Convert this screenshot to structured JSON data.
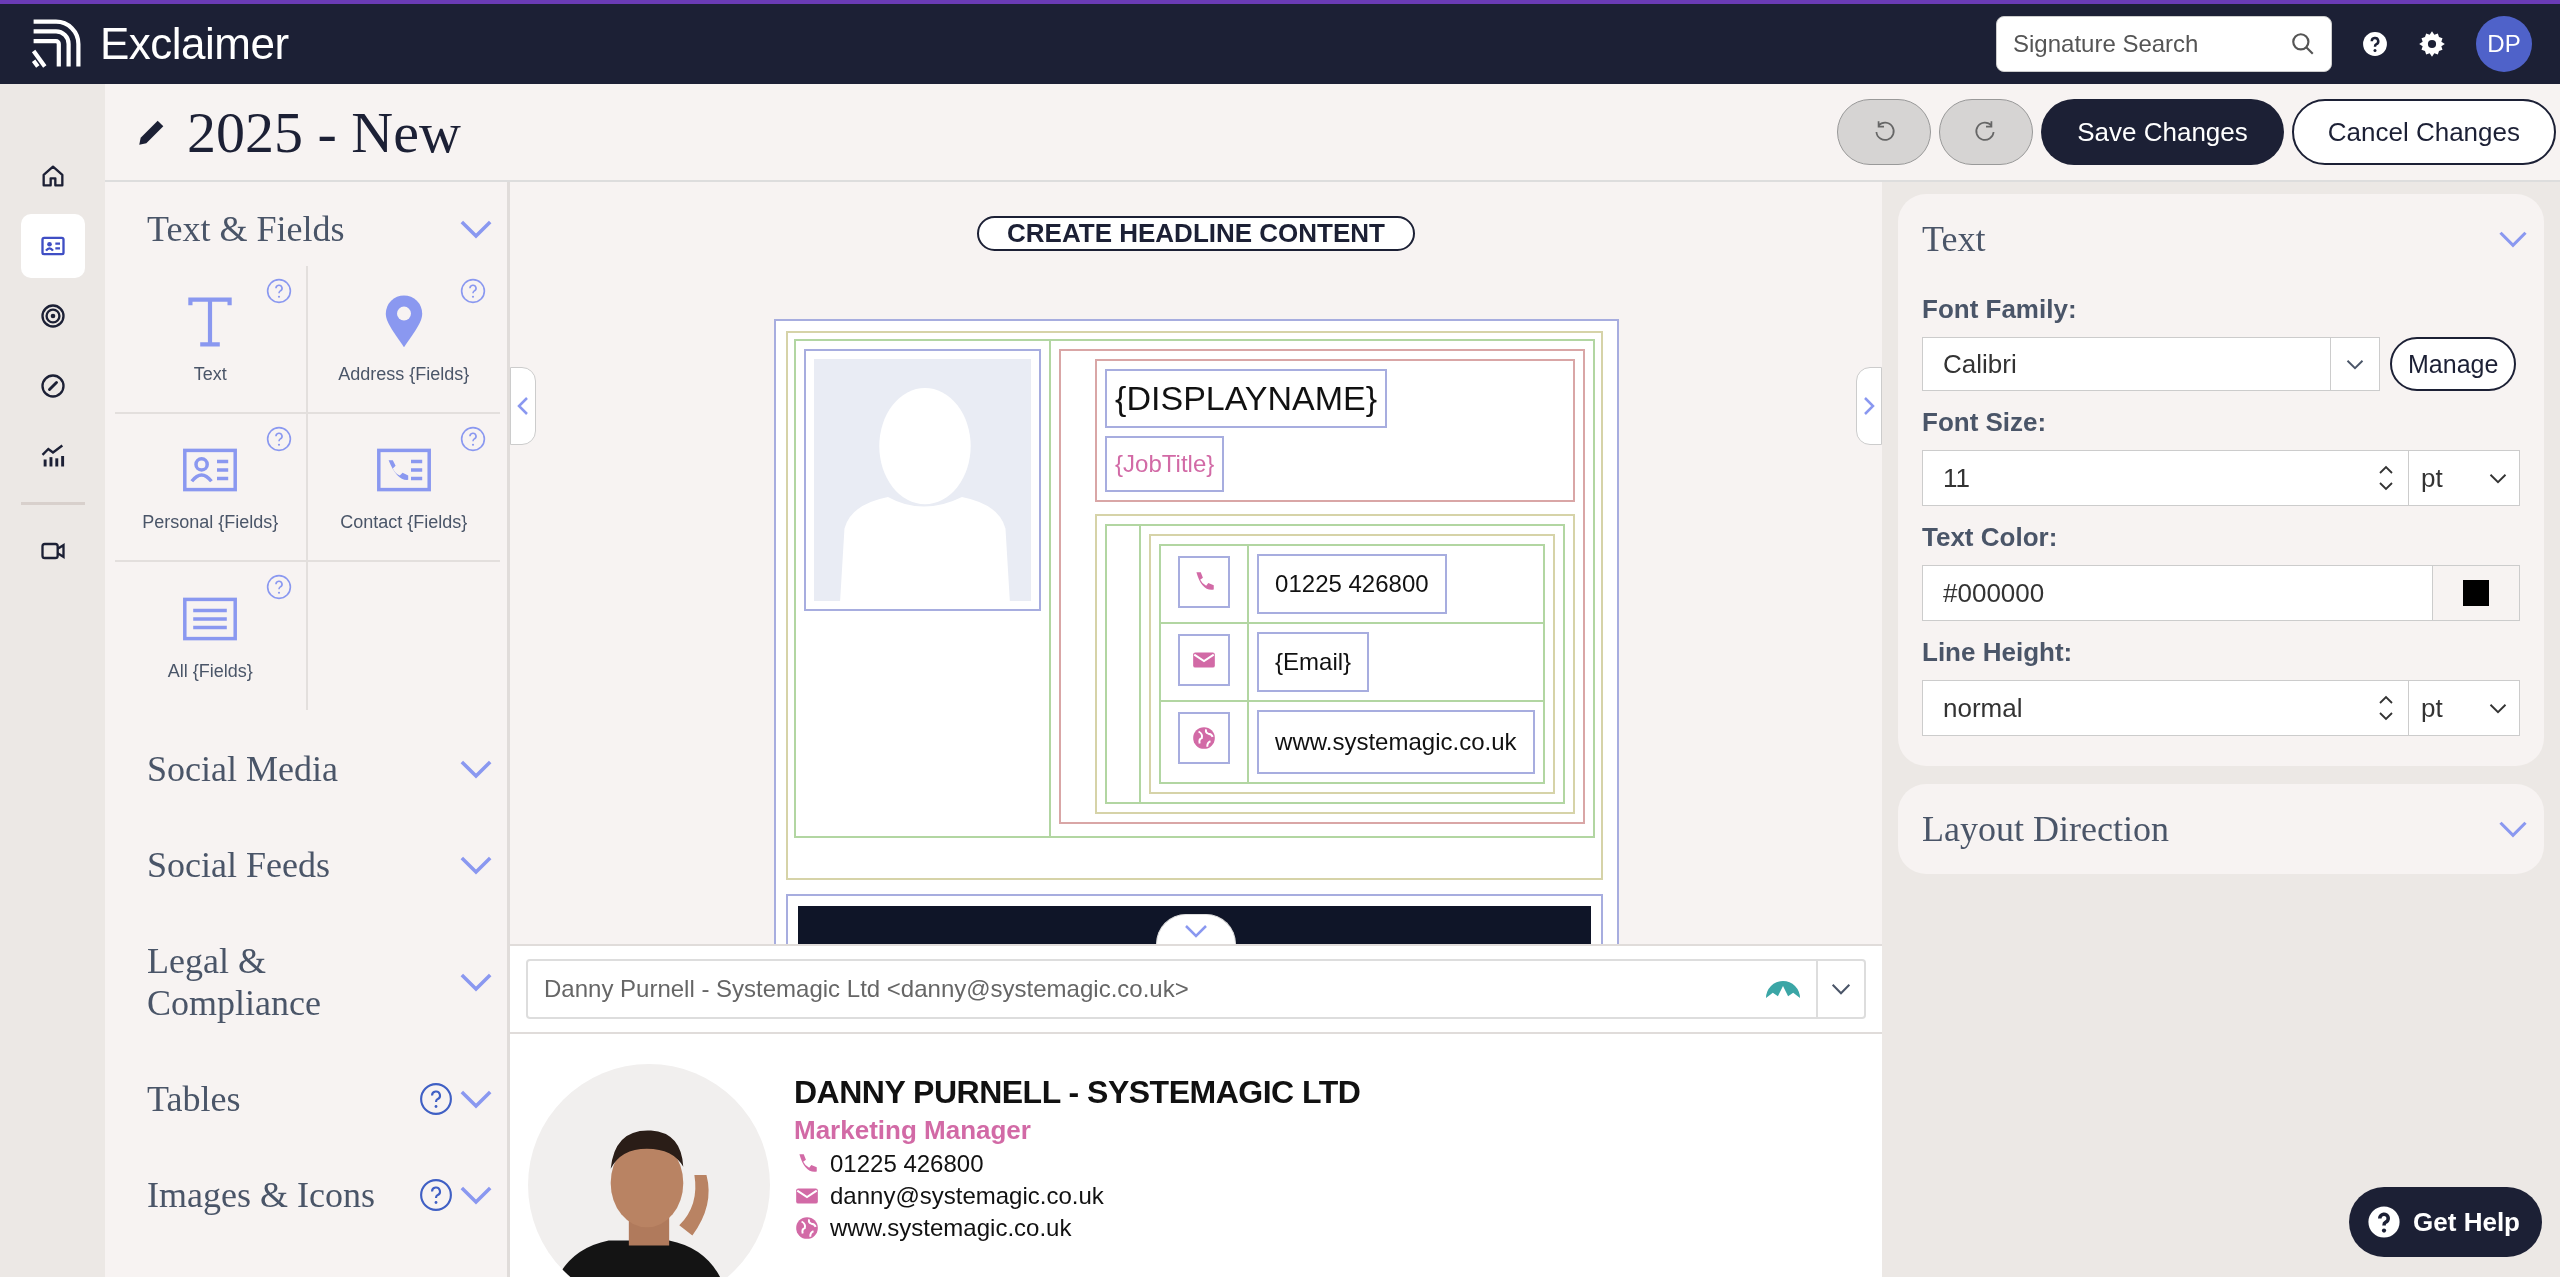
{
  "topbar": {
    "logo": "Exclaimer",
    "search": {
      "placeholder": "Signature Search"
    },
    "avatar": "DP"
  },
  "header": {
    "title": "2025 - New",
    "undo": {
      "disabled": true
    },
    "redo": {
      "disabled": true
    },
    "save": "Save Changes",
    "cancel": "Cancel Changes"
  },
  "rail": [
    {
      "kind": "home",
      "selected": false
    },
    {
      "kind": "card",
      "selected": true
    },
    {
      "kind": "target",
      "selected": false
    },
    {
      "kind": "gauge",
      "selected": false
    },
    {
      "kind": "chart",
      "selected": false
    },
    {
      "kind": "video",
      "selected": false
    }
  ],
  "sections": [
    {
      "title": "Text & Fields",
      "help": false,
      "tiles": [
        {
          "kind": "text",
          "label": "Text"
        },
        {
          "kind": "pin",
          "label": "Address {Fields}"
        },
        {
          "kind": "person",
          "label": "Personal {Fields}"
        },
        {
          "kind": "contact",
          "label": "Contact {Fields}"
        },
        {
          "kind": "lines",
          "label": "All {Fields}"
        }
      ]
    },
    {
      "title": "Social Media",
      "help": false
    },
    {
      "title": "Social Feeds",
      "help": false
    },
    {
      "title": "Legal & Compliance",
      "help": false
    },
    {
      "title": "Tables",
      "help": true
    },
    {
      "title": "Images & Icons",
      "help": true
    }
  ],
  "canvas": {
    "headline_button": "CREATE HEADLINE CONTENT",
    "display_name": "{DISPLAYNAME}",
    "job_title": "{JobTitle}",
    "contacts": [
      {
        "kind": "phone",
        "text": "01225 426800"
      },
      {
        "kind": "email",
        "text": "{Email}"
      },
      {
        "kind": "web",
        "text": "www.systemagic.co.uk"
      }
    ]
  },
  "preview": {
    "sender": "Danny Purnell - Systemagic Ltd <danny@systemagic.co.uk>",
    "name": "DANNY PURNELL - SYSTEMAGIC LTD",
    "role": "Marketing Manager",
    "contacts": [
      {
        "kind": "phone",
        "text": "01225 426800"
      },
      {
        "kind": "email",
        "text": "danny@systemagic.co.uk"
      },
      {
        "kind": "web",
        "text": "www.systemagic.co.uk"
      }
    ]
  },
  "properties": {
    "title": "Text",
    "font_family": {
      "label": "Font Family:",
      "value": "Calibri",
      "button": "Manage"
    },
    "font_size": {
      "label": "Font Size:",
      "value": "11",
      "unit": "pt"
    },
    "text_color": {
      "label": "Text Color:",
      "value": "#000000"
    },
    "line_height": {
      "label": "Line Height:",
      "value": "normal",
      "unit": "pt"
    }
  },
  "layout_direction": {
    "title": "Layout Direction"
  },
  "help_button": "Get Help"
}
